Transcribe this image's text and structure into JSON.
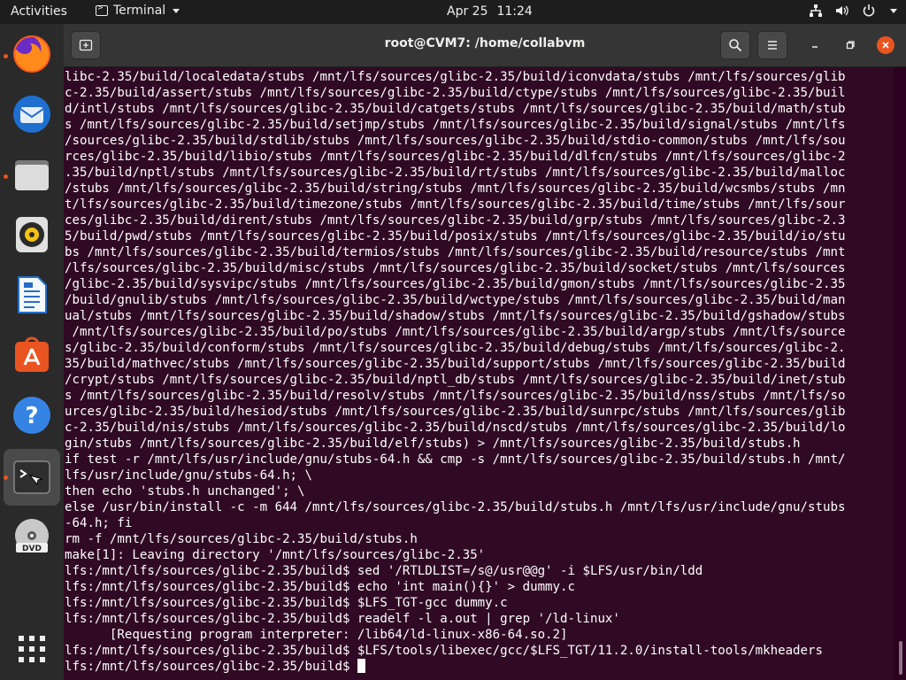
{
  "topbar": {
    "activities": "Activities",
    "app_name": "Terminal",
    "date": "Apr 25",
    "time": "11:24"
  },
  "dock": {
    "items": [
      "firefox-icon",
      "thunderbird-icon",
      "files-icon",
      "rhythmbox-icon",
      "libreoffice-writer-icon",
      "app-center-icon",
      "help-icon",
      "terminal-icon",
      "dvd-icon",
      "show-apps-icon"
    ]
  },
  "window": {
    "title": "root@CVM7: /home/collabvm"
  },
  "terminal": {
    "lines": [
      "libc-2.35/build/localedata/stubs /mnt/lfs/sources/glibc-2.35/build/iconvdata/stubs /mnt/lfs/sources/glib",
      "c-2.35/build/assert/stubs /mnt/lfs/sources/glibc-2.35/build/ctype/stubs /mnt/lfs/sources/glibc-2.35/buil",
      "d/intl/stubs /mnt/lfs/sources/glibc-2.35/build/catgets/stubs /mnt/lfs/sources/glibc-2.35/build/math/stub",
      "s /mnt/lfs/sources/glibc-2.35/build/setjmp/stubs /mnt/lfs/sources/glibc-2.35/build/signal/stubs /mnt/lfs",
      "/sources/glibc-2.35/build/stdlib/stubs /mnt/lfs/sources/glibc-2.35/build/stdio-common/stubs /mnt/lfs/sou",
      "rces/glibc-2.35/build/libio/stubs /mnt/lfs/sources/glibc-2.35/build/dlfcn/stubs /mnt/lfs/sources/glibc-2",
      ".35/build/nptl/stubs /mnt/lfs/sources/glibc-2.35/build/rt/stubs /mnt/lfs/sources/glibc-2.35/build/malloc",
      "/stubs /mnt/lfs/sources/glibc-2.35/build/string/stubs /mnt/lfs/sources/glibc-2.35/build/wcsmbs/stubs /mn",
      "t/lfs/sources/glibc-2.35/build/timezone/stubs /mnt/lfs/sources/glibc-2.35/build/time/stubs /mnt/lfs/sour",
      "ces/glibc-2.35/build/dirent/stubs /mnt/lfs/sources/glibc-2.35/build/grp/stubs /mnt/lfs/sources/glibc-2.3",
      "5/build/pwd/stubs /mnt/lfs/sources/glibc-2.35/build/posix/stubs /mnt/lfs/sources/glibc-2.35/build/io/stu",
      "bs /mnt/lfs/sources/glibc-2.35/build/termios/stubs /mnt/lfs/sources/glibc-2.35/build/resource/stubs /mnt",
      "/lfs/sources/glibc-2.35/build/misc/stubs /mnt/lfs/sources/glibc-2.35/build/socket/stubs /mnt/lfs/sources",
      "/glibc-2.35/build/sysvipc/stubs /mnt/lfs/sources/glibc-2.35/build/gmon/stubs /mnt/lfs/sources/glibc-2.35",
      "/build/gnulib/stubs /mnt/lfs/sources/glibc-2.35/build/wctype/stubs /mnt/lfs/sources/glibc-2.35/build/man",
      "ual/stubs /mnt/lfs/sources/glibc-2.35/build/shadow/stubs /mnt/lfs/sources/glibc-2.35/build/gshadow/stubs",
      " /mnt/lfs/sources/glibc-2.35/build/po/stubs /mnt/lfs/sources/glibc-2.35/build/argp/stubs /mnt/lfs/source",
      "s/glibc-2.35/build/conform/stubs /mnt/lfs/sources/glibc-2.35/build/debug/stubs /mnt/lfs/sources/glibc-2.",
      "35/build/mathvec/stubs /mnt/lfs/sources/glibc-2.35/build/support/stubs /mnt/lfs/sources/glibc-2.35/build",
      "/crypt/stubs /mnt/lfs/sources/glibc-2.35/build/nptl_db/stubs /mnt/lfs/sources/glibc-2.35/build/inet/stub",
      "s /mnt/lfs/sources/glibc-2.35/build/resolv/stubs /mnt/lfs/sources/glibc-2.35/build/nss/stubs /mnt/lfs/so",
      "urces/glibc-2.35/build/hesiod/stubs /mnt/lfs/sources/glibc-2.35/build/sunrpc/stubs /mnt/lfs/sources/glib",
      "c-2.35/build/nis/stubs /mnt/lfs/sources/glibc-2.35/build/nscd/stubs /mnt/lfs/sources/glibc-2.35/build/lo",
      "gin/stubs /mnt/lfs/sources/glibc-2.35/build/elf/stubs) > /mnt/lfs/sources/glibc-2.35/build/stubs.h",
      "if test -r /mnt/lfs/usr/include/gnu/stubs-64.h && cmp -s /mnt/lfs/sources/glibc-2.35/build/stubs.h /mnt/",
      "lfs/usr/include/gnu/stubs-64.h; \\",
      "then echo 'stubs.h unchanged'; \\",
      "else /usr/bin/install -c -m 644 /mnt/lfs/sources/glibc-2.35/build/stubs.h /mnt/lfs/usr/include/gnu/stubs",
      "-64.h; fi",
      "rm -f /mnt/lfs/sources/glibc-2.35/build/stubs.h",
      "make[1]: Leaving directory '/mnt/lfs/sources/glibc-2.35'",
      "lfs:/mnt/lfs/sources/glibc-2.35/build$ sed '/RTLDLIST=/s@/usr@@g' -i $LFS/usr/bin/ldd",
      "lfs:/mnt/lfs/sources/glibc-2.35/build$ echo 'int main(){}' > dummy.c",
      "lfs:/mnt/lfs/sources/glibc-2.35/build$ $LFS_TGT-gcc dummy.c",
      "lfs:/mnt/lfs/sources/glibc-2.35/build$ readelf -l a.out | grep '/ld-linux'",
      "      [Requesting program interpreter: /lib64/ld-linux-x86-64.so.2]",
      "lfs:/mnt/lfs/sources/glibc-2.35/build$ $LFS/tools/libexec/gcc/$LFS_TGT/11.2.0/install-tools/mkheaders"
    ],
    "prompt": "lfs:/mnt/lfs/sources/glibc-2.35/build$ "
  }
}
